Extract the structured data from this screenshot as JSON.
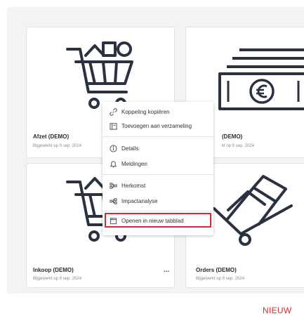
{
  "cards": [
    {
      "title": "Afzet (DEMO)",
      "updated": "Bijgewerkt op 9 sep. 2024",
      "icon": "shopping-cart-icon"
    },
    {
      "title": "(DEMO)",
      "updated": "kt op 9 sep. 2024",
      "icon": "banknotes-euro-icon"
    },
    {
      "title": "Inkoop (DEMO)",
      "updated": "Bijgewerkt op 9 sep. 2024",
      "icon": "shopping-cart-icon",
      "more": "..."
    },
    {
      "title": "Orders (DEMO)",
      "updated": "Bijgewerkt op 9 sep. 2024",
      "icon": "hand-truck-icon"
    }
  ],
  "context_menu": {
    "items": [
      {
        "label": "Koppeling kopiëren",
        "icon": "link-icon"
      },
      {
        "label": "Toevoegen aan verzameling",
        "icon": "collection-icon"
      },
      {
        "label": "Details",
        "icon": "info-icon"
      },
      {
        "label": "Meldingen",
        "icon": "bell-icon"
      },
      {
        "label": "Herkomst",
        "icon": "lineage-icon"
      },
      {
        "label": "Impactanalyse",
        "icon": "impact-analysis-icon"
      },
      {
        "label": "Openen in nieuw tabblad",
        "icon": "open-new-tab-icon"
      }
    ]
  },
  "badge": "NIEUW",
  "colors": {
    "accent": "#d7292f",
    "panel": "#f3f3f3",
    "icon_stroke": "#2a3140"
  }
}
